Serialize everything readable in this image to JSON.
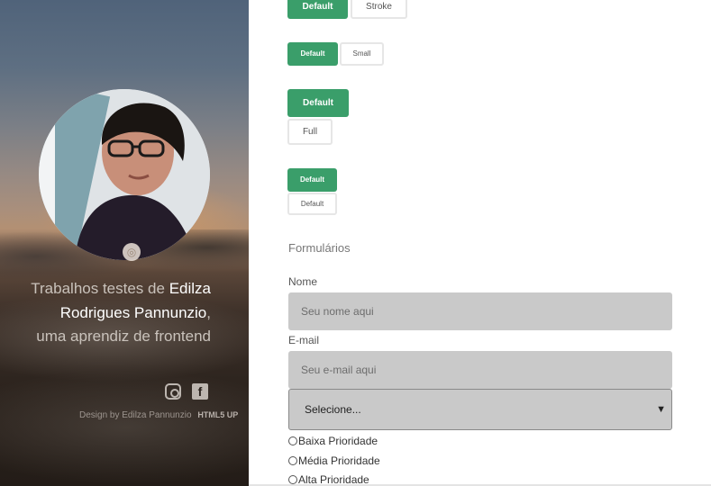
{
  "sidebar": {
    "intro_prefix": "Trabalhos testes de",
    "name": "Edilza Rodrigues Pannunzio",
    "intro_suffix": ", uma aprendiz de frontend",
    "credits_text": "Design by Edilza Pannunzio",
    "credits_link": "HTML5 UP",
    "social": [
      "instagram-icon",
      "facebook-icon"
    ]
  },
  "buttons": {
    "row1": {
      "primary": "Default",
      "stroke": "Stroke"
    },
    "row2": {
      "primary": "Default",
      "stroke": "Small"
    },
    "row3": {
      "primary": "Default",
      "stroke": "Full"
    },
    "row4": {
      "primary": "Default",
      "stroke": "Default"
    }
  },
  "form": {
    "section_title": "Formulários",
    "name_label": "Nome",
    "name_placeholder": "Seu nome aqui",
    "email_label": "E-mail",
    "email_placeholder": "Seu e-mail aqui",
    "select_value": "Selecione...",
    "radios": [
      "Baixa Prioridade",
      "Média Prioridade",
      "Alta Prioridade"
    ]
  },
  "colors": {
    "accent": "#3a9e6a",
    "field_bg": "#c9c9c9"
  }
}
